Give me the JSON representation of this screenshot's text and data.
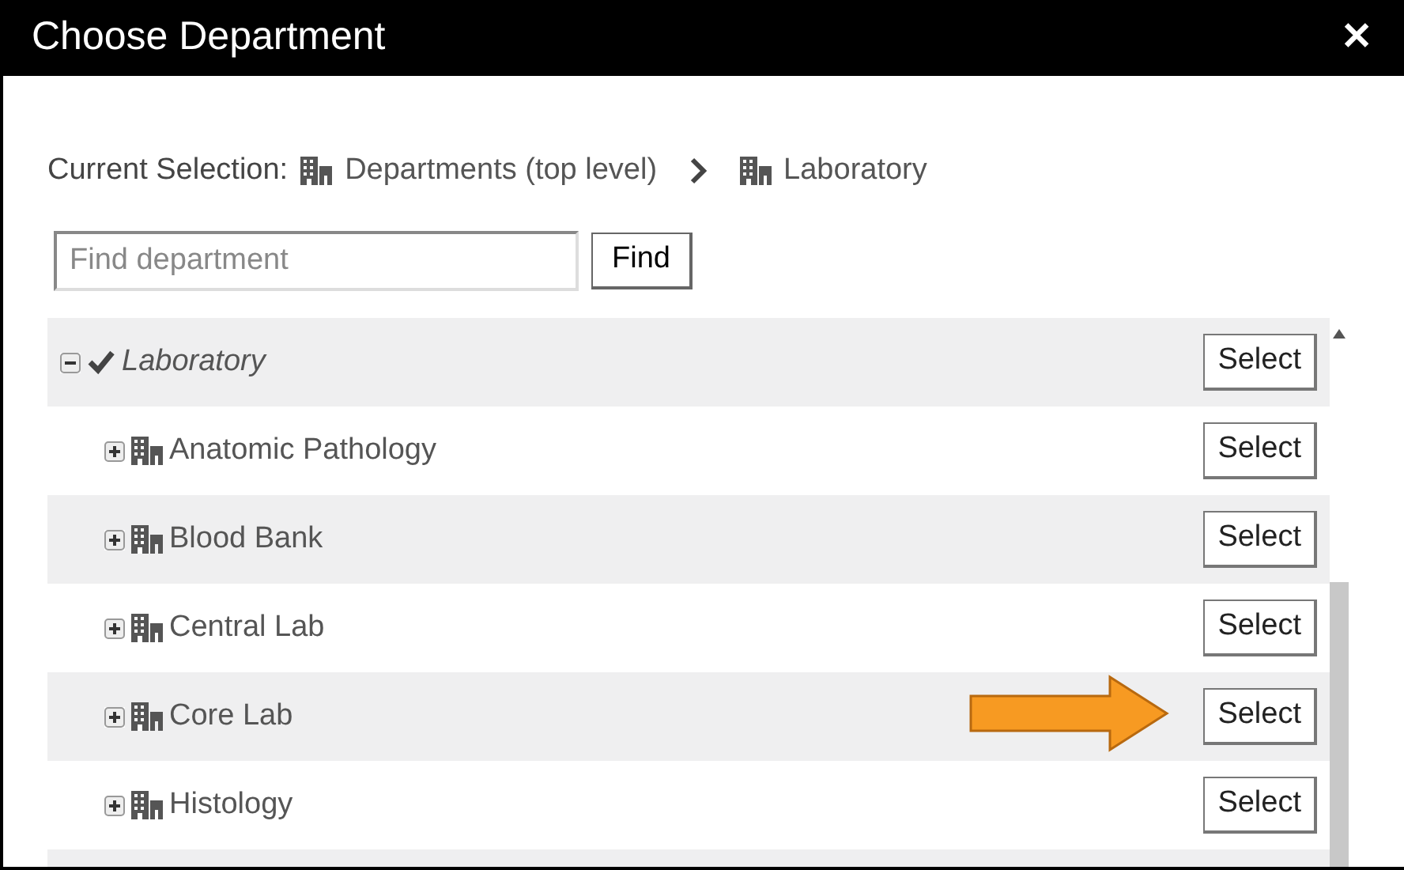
{
  "dialog": {
    "title": "Choose Department",
    "close": "✕"
  },
  "breadcrumb": {
    "label": "Current Selection:",
    "items": [
      "Departments (top level)",
      "Laboratory"
    ]
  },
  "search": {
    "placeholder": "Find department",
    "button": "Find"
  },
  "tree": [
    {
      "label": "Laboratory",
      "expanded": true,
      "current": true,
      "button": "Select",
      "pointed": false,
      "children": [
        {
          "label": "Anatomic Pathology",
          "expanded": false,
          "current": false,
          "button": "Select",
          "pointed": false
        },
        {
          "label": "Blood Bank",
          "expanded": false,
          "current": false,
          "button": "Select",
          "pointed": false
        },
        {
          "label": "Central Lab",
          "expanded": false,
          "current": false,
          "button": "Select",
          "pointed": false
        },
        {
          "label": "Core Lab",
          "expanded": false,
          "current": false,
          "button": "Select",
          "pointed": true
        },
        {
          "label": "Histology",
          "expanded": false,
          "current": false,
          "button": "Select",
          "pointed": false
        }
      ]
    }
  ]
}
